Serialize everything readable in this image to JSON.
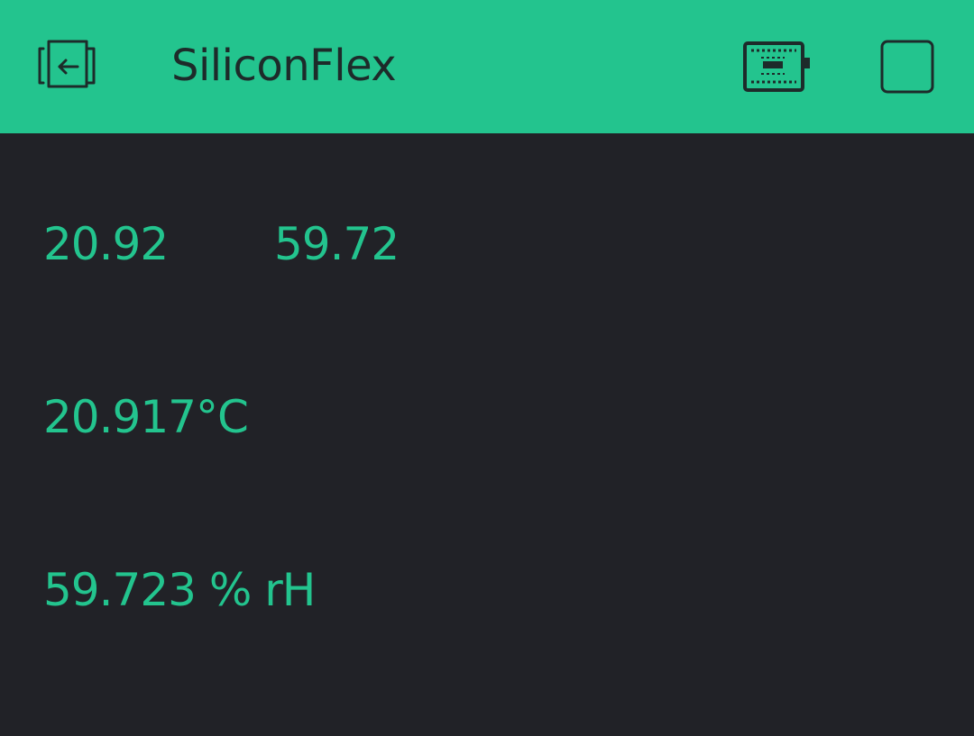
{
  "colors": {
    "accent": "#23c48e",
    "background": "#212227",
    "header_text": "#1d2b2a"
  },
  "header": {
    "title": "SiliconFlex",
    "icons": {
      "left": "exit-icon",
      "device": "device-icon",
      "stop": "stop-icon"
    }
  },
  "widgets": {
    "temperature_short": "20.92",
    "humidity_short": "59.72",
    "temperature_long": "20.917°C",
    "humidity_long": "59.723 % rH"
  }
}
